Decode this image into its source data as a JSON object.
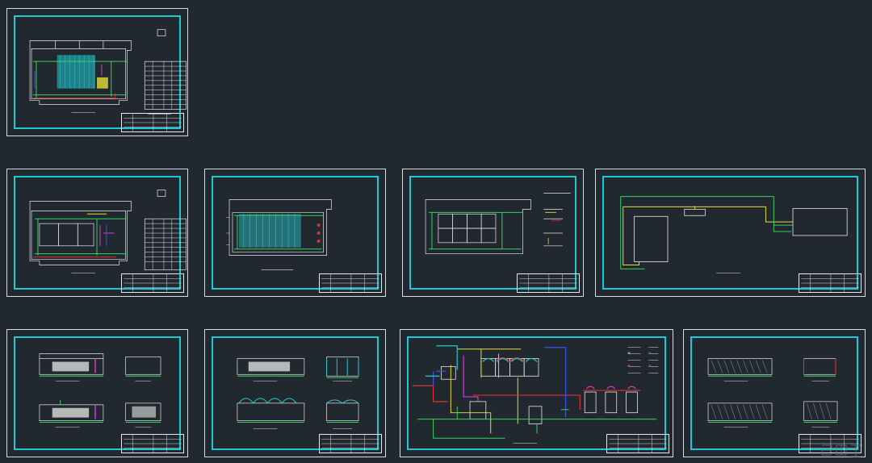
{
  "canvas": {
    "background": "#212830",
    "sheet_border_color": "#d8dde2",
    "frame_color": "#1ecbd4"
  },
  "line_colors": {
    "white": "#e8e8e8",
    "yellow": "#e3df36",
    "green": "#34d45a",
    "red": "#e0322f",
    "cyan": "#27c9d1",
    "blue": "#3557e6",
    "magenta": "#d23ad0",
    "gray": "#9aa0a6"
  },
  "drawing_sheets": [
    {
      "id": "sheet-1",
      "type": "floor-plan-water"
    },
    {
      "id": "sheet-2",
      "type": "floor-plan-rooms"
    },
    {
      "id": "sheet-3",
      "type": "floor-plan-tanks"
    },
    {
      "id": "sheet-4",
      "type": "floor-plan-details"
    },
    {
      "id": "sheet-5",
      "type": "site-plan"
    },
    {
      "id": "sheet-6",
      "type": "sections"
    },
    {
      "id": "sheet-7",
      "type": "sections-arched"
    },
    {
      "id": "sheet-8",
      "type": "process-flow"
    },
    {
      "id": "sheet-9",
      "type": "sections-hatched"
    }
  ],
  "icons": {
    "watermark": "logo-watermark-icon"
  }
}
